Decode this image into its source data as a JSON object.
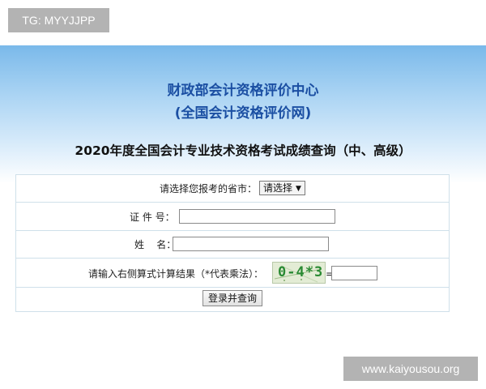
{
  "tag_badge": "TG: MYYJJPP",
  "header": {
    "org_line1": "财政部会计资格评价中心",
    "org_line2": "(全国会计资格评价网)",
    "page_title": "2020年度全国会计专业技术资格考试成绩查询（中、高级）"
  },
  "form": {
    "province_label": "请选择您报考的省市：",
    "province_selected": "请选择",
    "id_label": "证 件 号：",
    "id_value": "",
    "name_label": "姓    名：",
    "name_value": "",
    "captcha_label": "请输入右侧算式计算结果（*代表乘法）：",
    "captcha_text": "0-4*3",
    "equals": "=",
    "captcha_answer": "",
    "submit_label": "登录并查询"
  },
  "watermark": "www.kaiyousou.org",
  "colors": {
    "header_gradient_top": "#7ab9ea",
    "title_blue": "#1b4fa3",
    "badge_gray": "#b3b3b3",
    "table_border": "#cfe0ea",
    "captcha_green": "#2a8a33"
  },
  "icons": {
    "select_arrow": "triangle-down-icon"
  }
}
